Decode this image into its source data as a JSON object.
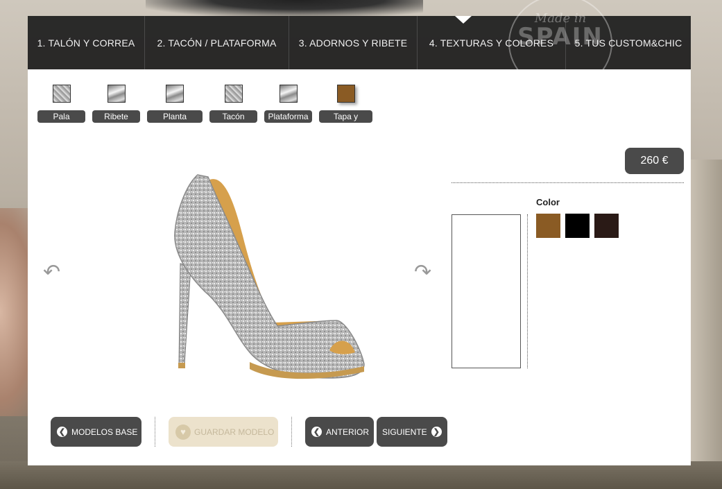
{
  "nav": {
    "items": [
      {
        "label": "1. TALÓN Y CORREA"
      },
      {
        "label": "2. TACÓN / PLATAFORMA"
      },
      {
        "label": "3. ADORNOS Y RIBETE"
      },
      {
        "label": "4. TEXTURAS Y COLORES"
      },
      {
        "label": "5. TUS CUSTOM&CHIC"
      }
    ],
    "active_index": 3
  },
  "badge": {
    "line1": "Made in",
    "line2": "SPAIN"
  },
  "parts": [
    {
      "label": "Pala",
      "texture": "glitter"
    },
    {
      "label": "Ribete",
      "texture": "metal"
    },
    {
      "label": "Planta Interior",
      "texture": "metal"
    },
    {
      "label": "Tacón",
      "texture": "glitter"
    },
    {
      "label": "Plataforma",
      "texture": "metal"
    },
    {
      "label": "Tapa y Canto",
      "texture": "brown"
    }
  ],
  "price": "260 €",
  "color_section": {
    "label": "Color",
    "swatches": [
      "#8a5b24",
      "#000000",
      "#2a1a16"
    ]
  },
  "buttons": {
    "base_models": "MODELOS BASE",
    "save_model": "GUARDAR MODELO",
    "previous": "ANTERIOR",
    "next": "SIGUIENTE"
  },
  "colors": {
    "nav_bg": "#1c1c1c",
    "button_bg": "#4a4a4a",
    "save_disabled_bg": "#ece2cc"
  }
}
